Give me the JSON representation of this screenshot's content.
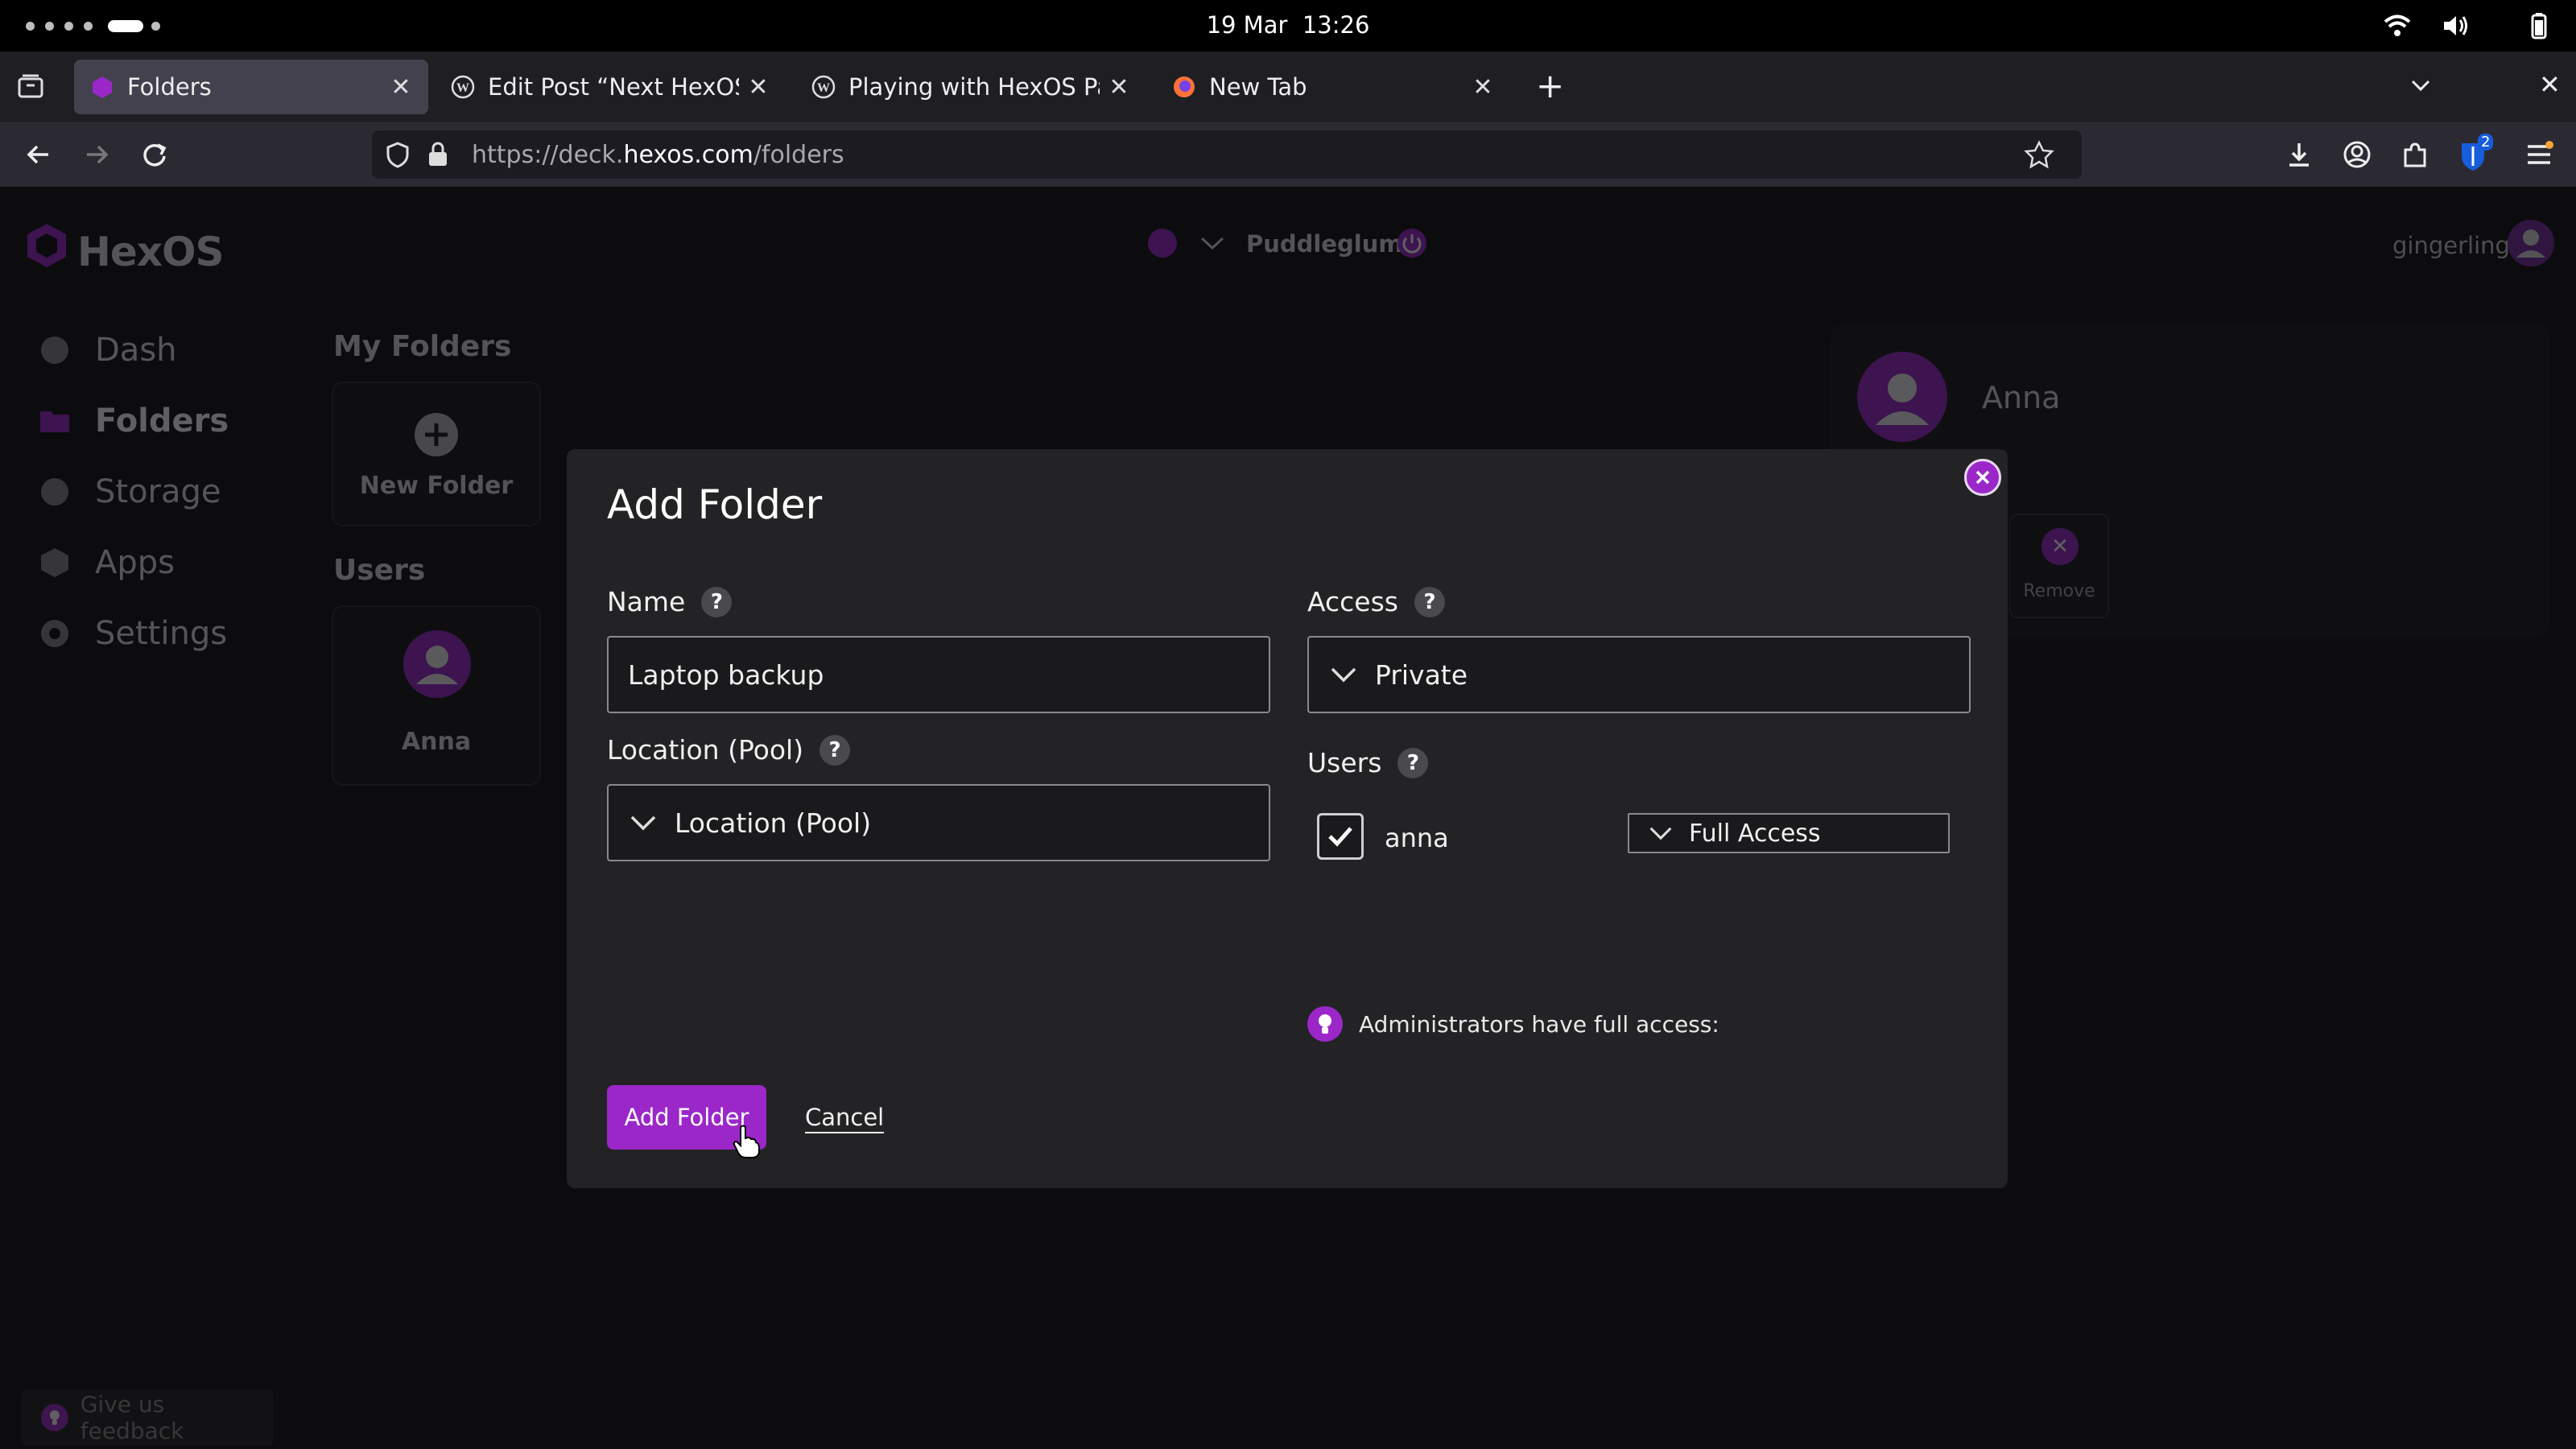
{
  "system": {
    "date": "19 Mar",
    "time": "13:26"
  },
  "browser": {
    "tabs": [
      {
        "title": "Folders",
        "icon": "hexos-favicon",
        "active": true
      },
      {
        "title": "Edit Post “Next HexOS” ‹",
        "icon": "wordpress-favicon",
        "active": false
      },
      {
        "title": "Playing with HexOS Part 1",
        "icon": "wordpress-favicon",
        "active": false
      },
      {
        "title": "New Tab",
        "icon": "firefox-favicon",
        "active": false
      }
    ],
    "url_prefix": "https://deck.",
    "url_domain": "hexos.com",
    "url_path": "/folders",
    "extension_badge": "2"
  },
  "app": {
    "logo": "HexOS",
    "server_name": "Puddleglum",
    "username": "gingerling",
    "sidebar": [
      {
        "label": "Dash",
        "icon": "gauge-icon"
      },
      {
        "label": "Folders",
        "icon": "folder-icon",
        "active": true
      },
      {
        "label": "Storage",
        "icon": "storage-icon"
      },
      {
        "label": "Apps",
        "icon": "apps-icon"
      },
      {
        "label": "Settings",
        "icon": "gear-icon"
      }
    ],
    "my_folders_title": "My Folders",
    "new_folder_label": "New Folder",
    "users_title": "Users",
    "user_card_name": "Anna",
    "user_pane_name": "Anna",
    "user_pane_action": "Remove",
    "feedback_label": "Give us feedback"
  },
  "modal": {
    "title": "Add Folder",
    "name_label": "Name",
    "name_value": "Laptop backup",
    "location_label": "Location (Pool)",
    "location_placeholder": "Location (Pool)",
    "access_label": "Access",
    "access_value": "Private",
    "users_label": "Users",
    "user_row": {
      "name": "anna",
      "checked": true,
      "permission": "Full Access"
    },
    "admin_note": "Administrators have full access:",
    "add_button": "Add Folder",
    "cancel_button": "Cancel"
  },
  "colors": {
    "accent": "#9b27c9",
    "background": "#0c0c0e",
    "modal": "#232325"
  }
}
